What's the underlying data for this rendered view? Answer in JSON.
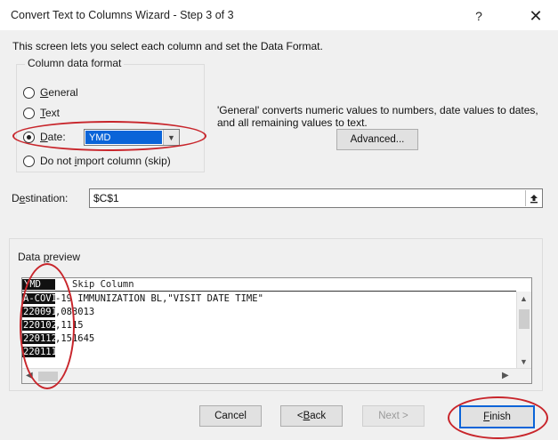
{
  "window": {
    "title": "Convert Text to Columns Wizard - Step 3 of 3",
    "help_glyph": "?",
    "close_glyph": "✕"
  },
  "intro": "This screen lets you select each column and set the Data Format.",
  "column_data_format": {
    "group_label": "Column data format",
    "options": [
      {
        "prefix": "",
        "underline": "G",
        "suffix": "eneral",
        "selected": false
      },
      {
        "prefix": "",
        "underline": "T",
        "suffix": "ext",
        "selected": false
      },
      {
        "prefix": "",
        "underline": "D",
        "suffix": "ate:",
        "selected": true
      },
      {
        "prefix": "Do not ",
        "underline": "i",
        "suffix": "mport column (skip)",
        "selected": false
      }
    ],
    "date_format_selected": "YMD"
  },
  "note": "'General' converts numeric values to numbers, date values to dates, and all remaining values to text.",
  "advanced_button": "Advanced...",
  "destination": {
    "label_prefix": "D",
    "label_underline": "e",
    "label_suffix": "stination:",
    "value": "$C$1"
  },
  "data_preview": {
    "label_prefix": "Data ",
    "label_underline": "p",
    "label_suffix": "review",
    "headers": [
      "YMD",
      "Skip Column"
    ],
    "rows": [
      [
        "A-COVID",
        "-19 IMMUNIZATION BL,\"VISIT DATE TIME\""
      ],
      [
        "2200918",
        ",083013"
      ],
      [
        "2201027",
        ",1115"
      ],
      [
        "2201124",
        ",151645"
      ],
      [
        "2201116",
        ""
      ]
    ]
  },
  "buttons": {
    "cancel": "Cancel",
    "back_prefix": "< ",
    "back_underline": "B",
    "back_suffix": "ack",
    "next": "Next >",
    "finish_underline": "F",
    "finish_suffix": "inish"
  },
  "colors": {
    "selection_blue": "#0a64d8",
    "annotation_red": "#c8252b",
    "dialog_bg": "#f0f0f0"
  },
  "icons": [
    "help-icon",
    "close-icon",
    "chevron-down-icon",
    "collapse-dialog-icon",
    "scroll-up-icon",
    "scroll-down-icon",
    "scroll-left-icon",
    "scroll-right-icon"
  ]
}
